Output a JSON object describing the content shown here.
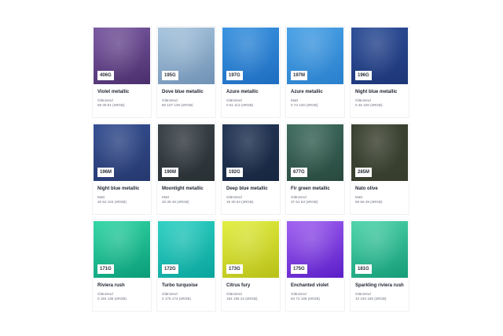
{
  "colors": [
    {
      "code": "406G",
      "name": "Violet metallic",
      "finish": "Glänzend",
      "rgb": "59 39 81 (sRGB)",
      "top": "#7a5aa2",
      "bottom": "#4a2e6c"
    },
    {
      "code": "195G",
      "name": "Dove blue metallic",
      "finish": "Glänzend",
      "rgb": "80 107 129 (sRGB)",
      "top": "#a9c6de",
      "bottom": "#6f91b4"
    },
    {
      "code": "197G",
      "name": "Azure metallic",
      "finish": "Glänzend",
      "rgb": "0 61 113 (sRGB)",
      "top": "#3a93e0",
      "bottom": "#1e6dc0"
    },
    {
      "code": "197M",
      "name": "Azure metallic",
      "finish": "Matt",
      "rgb": "0 74 126 (sRGB)",
      "top": "#4aa2e6",
      "bottom": "#2a80cc"
    },
    {
      "code": "196G",
      "name": "Night blue metallic",
      "finish": "Glänzend",
      "rgb": "0 45 100 (sRGB)",
      "top": "#2d4f98",
      "bottom": "#1c3576"
    },
    {
      "code": "196M",
      "name": "Night blue metallic",
      "finish": "Matt",
      "rgb": "20 52 104 (sRGB)",
      "top": "#354f92",
      "bottom": "#26386e"
    },
    {
      "code": "190M",
      "name": "Moonlight metallic",
      "finish": "Matt",
      "rgb": "33 35 46 (sRGB)",
      "top": "#3a4248",
      "bottom": "#283034"
    },
    {
      "code": "192G",
      "name": "Deep blue metallic",
      "finish": "Glänzend",
      "rgb": "19 30 64 (sRGB)",
      "top": "#233656",
      "bottom": "#172640"
    },
    {
      "code": "677G",
      "name": "Fir green metallic",
      "finish": "Glänzend",
      "rgb": "37 61 53 (sRGB)",
      "top": "#3e6c5e",
      "bottom": "#29493f"
    },
    {
      "code": "285M",
      "name": "Nato olive",
      "finish": "Matt",
      "rgb": "59 66 49 (sRGB)",
      "top": "#3c4231",
      "bottom": "#383e2e"
    },
    {
      "code": "171G",
      "name": "Riviera rush",
      "finish": "Glänzend",
      "rgb": "0 194 155 (sRGB)",
      "top": "#33d6a6",
      "bottom": "#0a9c78"
    },
    {
      "code": "172G",
      "name": "Turbo turquoise",
      "finish": "Glänzend",
      "rgb": "0 175 174 (sRGB)",
      "top": "#2fd0c4",
      "bottom": "#0aa49c"
    },
    {
      "code": "173G",
      "name": "Citrus fury",
      "finish": "Glänzend",
      "rgb": "184 185 24 (sRGB)",
      "top": "#e2ee40",
      "bottom": "#b8c018"
    },
    {
      "code": "175G",
      "name": "Enchanted violet",
      "finish": "Glänzend",
      "rgb": "84 72 169 (sRGB)",
      "top": "#a060f0",
      "bottom": "#5a1ec8"
    },
    {
      "code": "181G",
      "name": "Sparkling riviera rush",
      "finish": "Glänzend",
      "rgb": "10 194 155 (sRGB)",
      "top": "#4ed4aa",
      "bottom": "#159c78"
    }
  ]
}
